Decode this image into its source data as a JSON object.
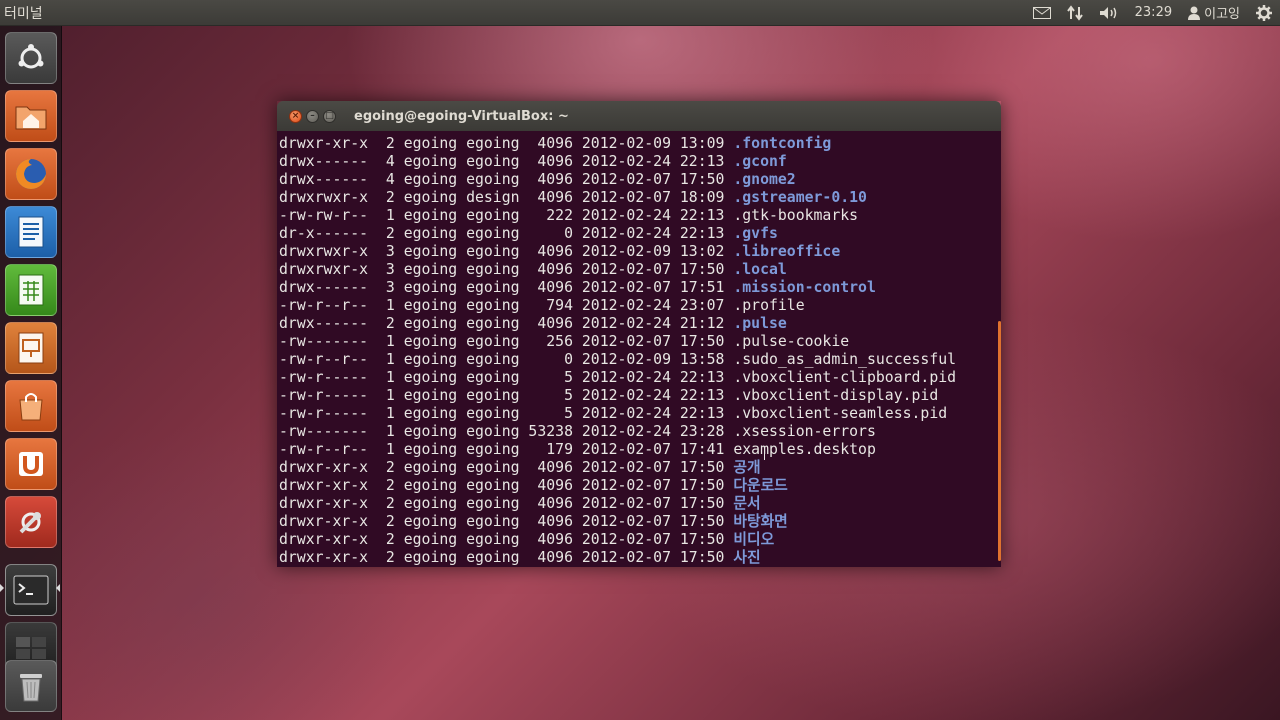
{
  "panel": {
    "app_title": "터미널",
    "clock": "23:29",
    "user": "이고잉"
  },
  "launcher": {
    "items": [
      {
        "name": "dash-home",
        "icon": "ubuntu-logo-icon"
      },
      {
        "name": "home-folder",
        "icon": "home-folder-icon"
      },
      {
        "name": "firefox",
        "icon": "firefox-icon"
      },
      {
        "name": "libreoffice-writer",
        "icon": "writer-icon"
      },
      {
        "name": "libreoffice-calc",
        "icon": "calc-icon"
      },
      {
        "name": "libreoffice-impress",
        "icon": "impress-icon"
      },
      {
        "name": "software-center",
        "icon": "shopping-bag-icon"
      },
      {
        "name": "ubuntu-one",
        "icon": "ubuntu-one-icon"
      },
      {
        "name": "system-settings",
        "icon": "settings-wrench-icon"
      },
      {
        "name": "terminal",
        "icon": "terminal-icon"
      },
      {
        "name": "workspace-switcher",
        "icon": "workspaces-icon"
      },
      {
        "name": "trash",
        "icon": "trash-icon"
      }
    ]
  },
  "window": {
    "title": "egoing@egoing-VirtualBox: ~"
  },
  "listing": {
    "rows": [
      {
        "meta": "drwxr-xr-x  2 egoing egoing  4096 2012-02-09 13:09 ",
        "name": ".fontconfig",
        "kind": "dir"
      },
      {
        "meta": "drwx------  4 egoing egoing  4096 2012-02-24 22:13 ",
        "name": ".gconf",
        "kind": "dir"
      },
      {
        "meta": "drwx------  4 egoing egoing  4096 2012-02-07 17:50 ",
        "name": ".gnome2",
        "kind": "dir"
      },
      {
        "meta": "drwxrwxr-x  2 egoing design  4096 2012-02-07 18:09 ",
        "name": ".gstreamer-0.10",
        "kind": "dir"
      },
      {
        "meta": "-rw-rw-r--  1 egoing egoing   222 2012-02-24 22:13 ",
        "name": ".gtk-bookmarks",
        "kind": "plain"
      },
      {
        "meta": "dr-x------  2 egoing egoing     0 2012-02-24 22:13 ",
        "name": ".gvfs",
        "kind": "dir"
      },
      {
        "meta": "drwxrwxr-x  3 egoing egoing  4096 2012-02-09 13:02 ",
        "name": ".libreoffice",
        "kind": "dir"
      },
      {
        "meta": "drwxrwxr-x  3 egoing egoing  4096 2012-02-07 17:50 ",
        "name": ".local",
        "kind": "dir"
      },
      {
        "meta": "drwx------  3 egoing egoing  4096 2012-02-07 17:51 ",
        "name": ".mission-control",
        "kind": "dir"
      },
      {
        "meta": "-rw-r--r--  1 egoing egoing   794 2012-02-24 23:07 ",
        "name": ".profile",
        "kind": "plain"
      },
      {
        "meta": "drwx------  2 egoing egoing  4096 2012-02-24 21:12 ",
        "name": ".pulse",
        "kind": "dir"
      },
      {
        "meta": "-rw-------  1 egoing egoing   256 2012-02-07 17:50 ",
        "name": ".pulse-cookie",
        "kind": "plain"
      },
      {
        "meta": "-rw-r--r--  1 egoing egoing     0 2012-02-09 13:58 ",
        "name": ".sudo_as_admin_successful",
        "kind": "plain"
      },
      {
        "meta": "-rw-r-----  1 egoing egoing     5 2012-02-24 22:13 ",
        "name": ".vboxclient-clipboard.pid",
        "kind": "plain"
      },
      {
        "meta": "-rw-r-----  1 egoing egoing     5 2012-02-24 22:13 ",
        "name": ".vboxclient-display.pid",
        "kind": "plain"
      },
      {
        "meta": "-rw-r-----  1 egoing egoing     5 2012-02-24 22:13 ",
        "name": ".vboxclient-seamless.pid",
        "kind": "plain"
      },
      {
        "meta": "-rw-------  1 egoing egoing 53238 2012-02-24 23:28 ",
        "name": ".xsession-errors",
        "kind": "plain"
      },
      {
        "meta": "-rw-r--r--  1 egoing egoing   179 2012-02-07 17:41 ",
        "name": "examples.desktop",
        "kind": "plain"
      },
      {
        "meta": "drwxr-xr-x  2 egoing egoing  4096 2012-02-07 17:50 ",
        "name": "공개",
        "kind": "dir"
      },
      {
        "meta": "drwxr-xr-x  2 egoing egoing  4096 2012-02-07 17:50 ",
        "name": "다운로드",
        "kind": "dir"
      },
      {
        "meta": "drwxr-xr-x  2 egoing egoing  4096 2012-02-07 17:50 ",
        "name": "문서",
        "kind": "dir"
      },
      {
        "meta": "drwxr-xr-x  2 egoing egoing  4096 2012-02-07 17:50 ",
        "name": "바탕화면",
        "kind": "dir"
      },
      {
        "meta": "drwxr-xr-x  2 egoing egoing  4096 2012-02-07 17:50 ",
        "name": "비디오",
        "kind": "dir"
      },
      {
        "meta": "drwxr-xr-x  2 egoing egoing  4096 2012-02-07 17:50 ",
        "name": "사진",
        "kind": "dir"
      }
    ]
  },
  "colors": {
    "terminal_bg": "#300a24",
    "dir_color": "#7e9ad9",
    "text_color": "#e8e6e3",
    "scrollbar": "#e0722f"
  }
}
